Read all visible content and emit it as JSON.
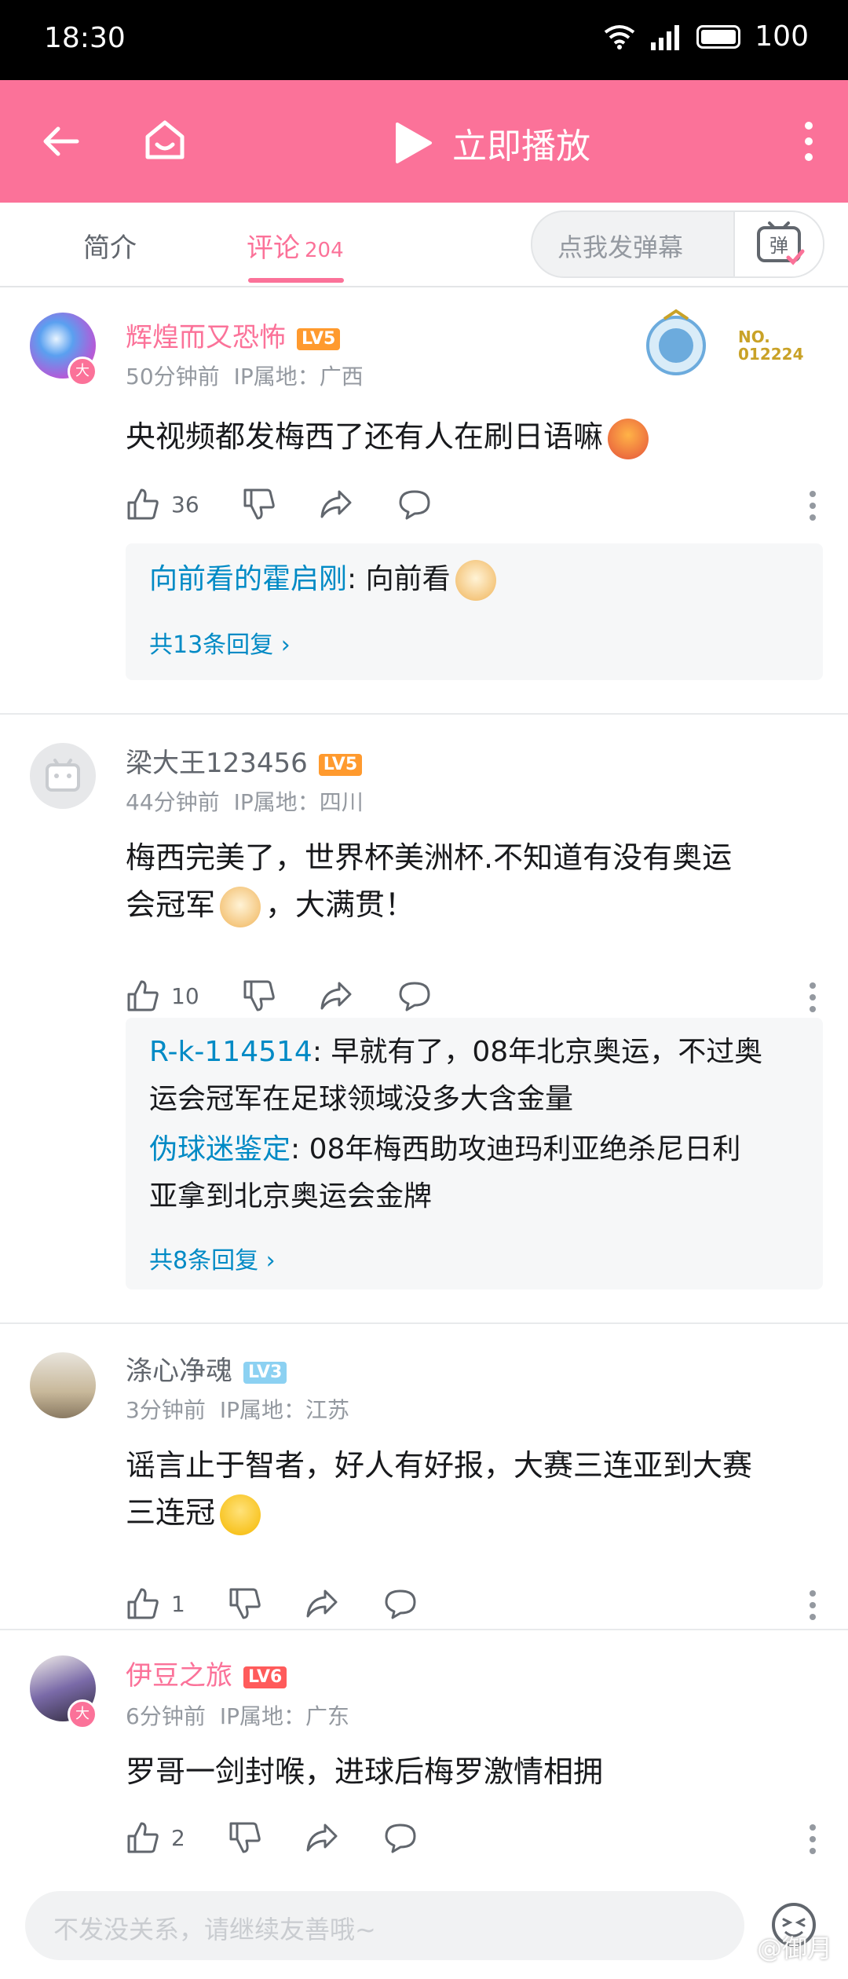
{
  "status": {
    "time": "18:30",
    "signal": "5G",
    "battery": "100"
  },
  "nav": {
    "play_label": "立即播放"
  },
  "tabs": {
    "intro": "简介",
    "comments": "评论",
    "comment_count": "204",
    "danmu_placeholder": "点我发弹幕",
    "danmu_btn": "弹"
  },
  "comments": [
    {
      "user": "辉煌而又恐怖",
      "level": "LV5",
      "vip": true,
      "time": "50分钟前",
      "ip": "IP属地：广西",
      "fan_badge": "NO.\n012224",
      "text": "央视频都发梅西了还有人在刷日语嘛",
      "likes": "36",
      "replies": [
        {
          "user": "向前看的霍启刚",
          "text": ": 向前看"
        }
      ],
      "reply_more": "共13条回复 ›"
    },
    {
      "user": "梁大王123456",
      "level": "LV5",
      "vip": false,
      "time": "44分钟前",
      "ip": "IP属地：四川",
      "text_a": "梅西完美了，世界杯美洲杯.不知道有没有奥运",
      "text_b": "会冠军",
      "text_c": "，大满贯！",
      "likes": "10",
      "replies": [
        {
          "user": "R-k-114514",
          "text": ": 早就有了，08年北京奥运，不过奥",
          "text2": "运会冠军在足球领域没多大含金量"
        },
        {
          "user": "伪球迷鉴定",
          "text": ": 08年梅西助攻迪玛利亚绝杀尼日利",
          "text2": "亚拿到北京奥运会金牌"
        }
      ],
      "reply_more": "共8条回复 ›"
    },
    {
      "user": "涤心净魂",
      "level": "LV3",
      "vip": false,
      "time": "3分钟前",
      "ip": "IP属地：江苏",
      "text_a": "谣言止于智者，好人有好报，大赛三连亚到大赛",
      "text_b": "三连冠",
      "likes": "1"
    },
    {
      "user": "伊豆之旅",
      "level": "LV6",
      "vip": true,
      "time": "6分钟前",
      "ip": "IP属地：广东",
      "text": "罗哥一剑封喉，进球后梅罗激情相拥",
      "likes": "2"
    }
  ],
  "bottom": {
    "placeholder": "不发没关系，请继续友善哦~"
  },
  "watermark": "@御月"
}
